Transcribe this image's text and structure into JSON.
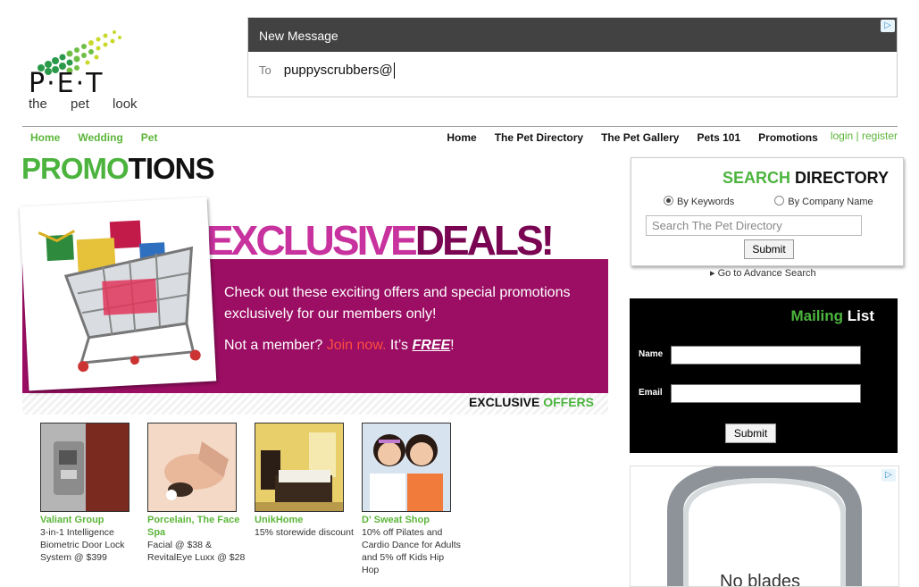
{
  "logo": {
    "letters": "P·E·T",
    "tagline": "the pet look"
  },
  "top_ad": {
    "header": "New Message",
    "to_label": "To",
    "to_value": "puppyscrubbers@",
    "adchoice": "▷"
  },
  "nav": {
    "left": [
      "Home",
      "Wedding",
      "Pet"
    ],
    "right": [
      "Home",
      "The Pet Directory",
      "The Pet Gallery",
      "Pets 101",
      "Promotions"
    ],
    "login": "login",
    "separator": "|",
    "register": "register"
  },
  "page_title": {
    "green": "PROMO",
    "black": "TIONS"
  },
  "banner": {
    "headline_a": "EXCLUSIVE",
    "headline_b": "DEALS!",
    "text": "Check out these exciting offers and special promotions exclusively for our members only!",
    "member_prefix": "Not a member?",
    "join": "Join now.",
    "its": "It’s",
    "free": "FREE",
    "bang": "!",
    "offers_a": "EXCLUSIVE",
    "offers_b": "OFFERS"
  },
  "offers": [
    {
      "name": "Valiant Group",
      "desc": "3-in-1 Intelligence Biometric Door Lock System @ $399"
    },
    {
      "name": "Porcelain, The Face Spa",
      "desc": "Facial @ $38 & RevitalEye Luxx @ $28"
    },
    {
      "name": "UnikHome",
      "desc": "15% storewide discount"
    },
    {
      "name": "D' Sweat Shop",
      "desc": "10% off Pilates and Cardio Dance for Adults and 5% off Kids Hip Hop"
    }
  ],
  "search": {
    "title_a": "SEARCH",
    "title_b": "DIRECTORY",
    "radio_keywords": "By Keywords",
    "radio_company": "By Company Name",
    "placeholder": "Search The Pet Directory",
    "button": "Submit",
    "advance": "▸ Go to Advance Search"
  },
  "mailing": {
    "title_a": "Mailing",
    "title_b": "List",
    "name_label": "Name",
    "email_label": "Email",
    "button": "Submit"
  },
  "side_ad": {
    "text": "No blades",
    "adchoice": "▷"
  },
  "colors": {
    "green": "#4cb43e",
    "magenta": "#9b0e63",
    "dark": "#111111"
  }
}
